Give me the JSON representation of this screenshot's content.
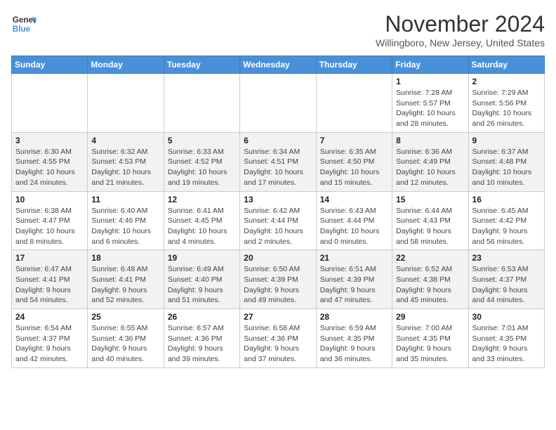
{
  "logo": {
    "line1": "General",
    "line2": "Blue"
  },
  "title": "November 2024",
  "location": "Willingboro, New Jersey, United States",
  "weekdays": [
    "Sunday",
    "Monday",
    "Tuesday",
    "Wednesday",
    "Thursday",
    "Friday",
    "Saturday"
  ],
  "weeks": [
    [
      {
        "day": "",
        "info": ""
      },
      {
        "day": "",
        "info": ""
      },
      {
        "day": "",
        "info": ""
      },
      {
        "day": "",
        "info": ""
      },
      {
        "day": "",
        "info": ""
      },
      {
        "day": "1",
        "info": "Sunrise: 7:28 AM\nSunset: 5:57 PM\nDaylight: 10 hours\nand 28 minutes."
      },
      {
        "day": "2",
        "info": "Sunrise: 7:29 AM\nSunset: 5:56 PM\nDaylight: 10 hours\nand 26 minutes."
      }
    ],
    [
      {
        "day": "3",
        "info": "Sunrise: 6:30 AM\nSunset: 4:55 PM\nDaylight: 10 hours\nand 24 minutes."
      },
      {
        "day": "4",
        "info": "Sunrise: 6:32 AM\nSunset: 4:53 PM\nDaylight: 10 hours\nand 21 minutes."
      },
      {
        "day": "5",
        "info": "Sunrise: 6:33 AM\nSunset: 4:52 PM\nDaylight: 10 hours\nand 19 minutes."
      },
      {
        "day": "6",
        "info": "Sunrise: 6:34 AM\nSunset: 4:51 PM\nDaylight: 10 hours\nand 17 minutes."
      },
      {
        "day": "7",
        "info": "Sunrise: 6:35 AM\nSunset: 4:50 PM\nDaylight: 10 hours\nand 15 minutes."
      },
      {
        "day": "8",
        "info": "Sunrise: 6:36 AM\nSunset: 4:49 PM\nDaylight: 10 hours\nand 12 minutes."
      },
      {
        "day": "9",
        "info": "Sunrise: 6:37 AM\nSunset: 4:48 PM\nDaylight: 10 hours\nand 10 minutes."
      }
    ],
    [
      {
        "day": "10",
        "info": "Sunrise: 6:38 AM\nSunset: 4:47 PM\nDaylight: 10 hours\nand 8 minutes."
      },
      {
        "day": "11",
        "info": "Sunrise: 6:40 AM\nSunset: 4:46 PM\nDaylight: 10 hours\nand 6 minutes."
      },
      {
        "day": "12",
        "info": "Sunrise: 6:41 AM\nSunset: 4:45 PM\nDaylight: 10 hours\nand 4 minutes."
      },
      {
        "day": "13",
        "info": "Sunrise: 6:42 AM\nSunset: 4:44 PM\nDaylight: 10 hours\nand 2 minutes."
      },
      {
        "day": "14",
        "info": "Sunrise: 6:43 AM\nSunset: 4:44 PM\nDaylight: 10 hours\nand 0 minutes."
      },
      {
        "day": "15",
        "info": "Sunrise: 6:44 AM\nSunset: 4:43 PM\nDaylight: 9 hours\nand 58 minutes."
      },
      {
        "day": "16",
        "info": "Sunrise: 6:45 AM\nSunset: 4:42 PM\nDaylight: 9 hours\nand 56 minutes."
      }
    ],
    [
      {
        "day": "17",
        "info": "Sunrise: 6:47 AM\nSunset: 4:41 PM\nDaylight: 9 hours\nand 54 minutes."
      },
      {
        "day": "18",
        "info": "Sunrise: 6:48 AM\nSunset: 4:41 PM\nDaylight: 9 hours\nand 52 minutes."
      },
      {
        "day": "19",
        "info": "Sunrise: 6:49 AM\nSunset: 4:40 PM\nDaylight: 9 hours\nand 51 minutes."
      },
      {
        "day": "20",
        "info": "Sunrise: 6:50 AM\nSunset: 4:39 PM\nDaylight: 9 hours\nand 49 minutes."
      },
      {
        "day": "21",
        "info": "Sunrise: 6:51 AM\nSunset: 4:39 PM\nDaylight: 9 hours\nand 47 minutes."
      },
      {
        "day": "22",
        "info": "Sunrise: 6:52 AM\nSunset: 4:38 PM\nDaylight: 9 hours\nand 45 minutes."
      },
      {
        "day": "23",
        "info": "Sunrise: 6:53 AM\nSunset: 4:37 PM\nDaylight: 9 hours\nand 44 minutes."
      }
    ],
    [
      {
        "day": "24",
        "info": "Sunrise: 6:54 AM\nSunset: 4:37 PM\nDaylight: 9 hours\nand 42 minutes."
      },
      {
        "day": "25",
        "info": "Sunrise: 6:55 AM\nSunset: 4:36 PM\nDaylight: 9 hours\nand 40 minutes."
      },
      {
        "day": "26",
        "info": "Sunrise: 6:57 AM\nSunset: 4:36 PM\nDaylight: 9 hours\nand 39 minutes."
      },
      {
        "day": "27",
        "info": "Sunrise: 6:58 AM\nSunset: 4:36 PM\nDaylight: 9 hours\nand 37 minutes."
      },
      {
        "day": "28",
        "info": "Sunrise: 6:59 AM\nSunset: 4:35 PM\nDaylight: 9 hours\nand 36 minutes."
      },
      {
        "day": "29",
        "info": "Sunrise: 7:00 AM\nSunset: 4:35 PM\nDaylight: 9 hours\nand 35 minutes."
      },
      {
        "day": "30",
        "info": "Sunrise: 7:01 AM\nSunset: 4:35 PM\nDaylight: 9 hours\nand 33 minutes."
      }
    ]
  ]
}
